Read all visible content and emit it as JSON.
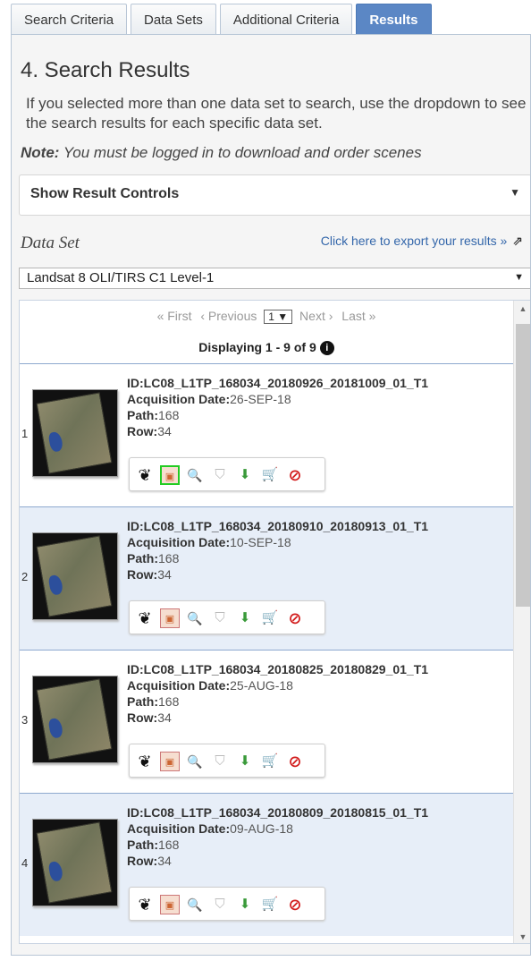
{
  "tabs": [
    {
      "label": "Search Criteria"
    },
    {
      "label": "Data Sets"
    },
    {
      "label": "Additional Criteria"
    },
    {
      "label": "Results"
    }
  ],
  "page": {
    "title": "4. Search Results",
    "intro": "If you selected more than one data set to search, use the dropdown to see the search results for each specific data set.",
    "note_label": "Note:",
    "note_text": " You must be logged in to download and order scenes"
  },
  "controls": {
    "label": "Show Result Controls",
    "caret": "▼"
  },
  "dataset": {
    "label": "Data Set",
    "export_text": "Click here to export your results »",
    "export_icon": "⇗",
    "selected": "Landsat 8 OLI/TIRS C1 Level-1",
    "caret": "▼"
  },
  "pager": {
    "first": "« First",
    "previous": "‹ Previous",
    "page": "1 ▼",
    "next": "Next ›",
    "last": "Last »",
    "displaying": "Displaying 1 - 9 of 9",
    "info_icon": "i"
  },
  "scroll": {
    "up": "▲",
    "down": "▼"
  },
  "icons": {
    "footprint": "❦",
    "browse": "▣",
    "metadata": "🔍",
    "compare": "⛉",
    "download": "⬇",
    "cart": "🛒",
    "exclude": "⊘"
  },
  "labels": {
    "acq": "Acquisition Date:",
    "path": "Path:",
    "row": "Row:"
  },
  "results": [
    {
      "num": "1",
      "id": "ID:LC08_L1TP_168034_20180926_20181009_01_T1",
      "date": "26-SEP-18",
      "path": "168",
      "row": "34"
    },
    {
      "num": "2",
      "id": "ID:LC08_L1TP_168034_20180910_20180913_01_T1",
      "date": "10-SEP-18",
      "path": "168",
      "row": "34"
    },
    {
      "num": "3",
      "id": "ID:LC08_L1TP_168034_20180825_20180829_01_T1",
      "date": "25-AUG-18",
      "path": "168",
      "row": "34"
    },
    {
      "num": "4",
      "id": "ID:LC08_L1TP_168034_20180809_20180815_01_T1",
      "date": "09-AUG-18",
      "path": "168",
      "row": "34"
    }
  ]
}
